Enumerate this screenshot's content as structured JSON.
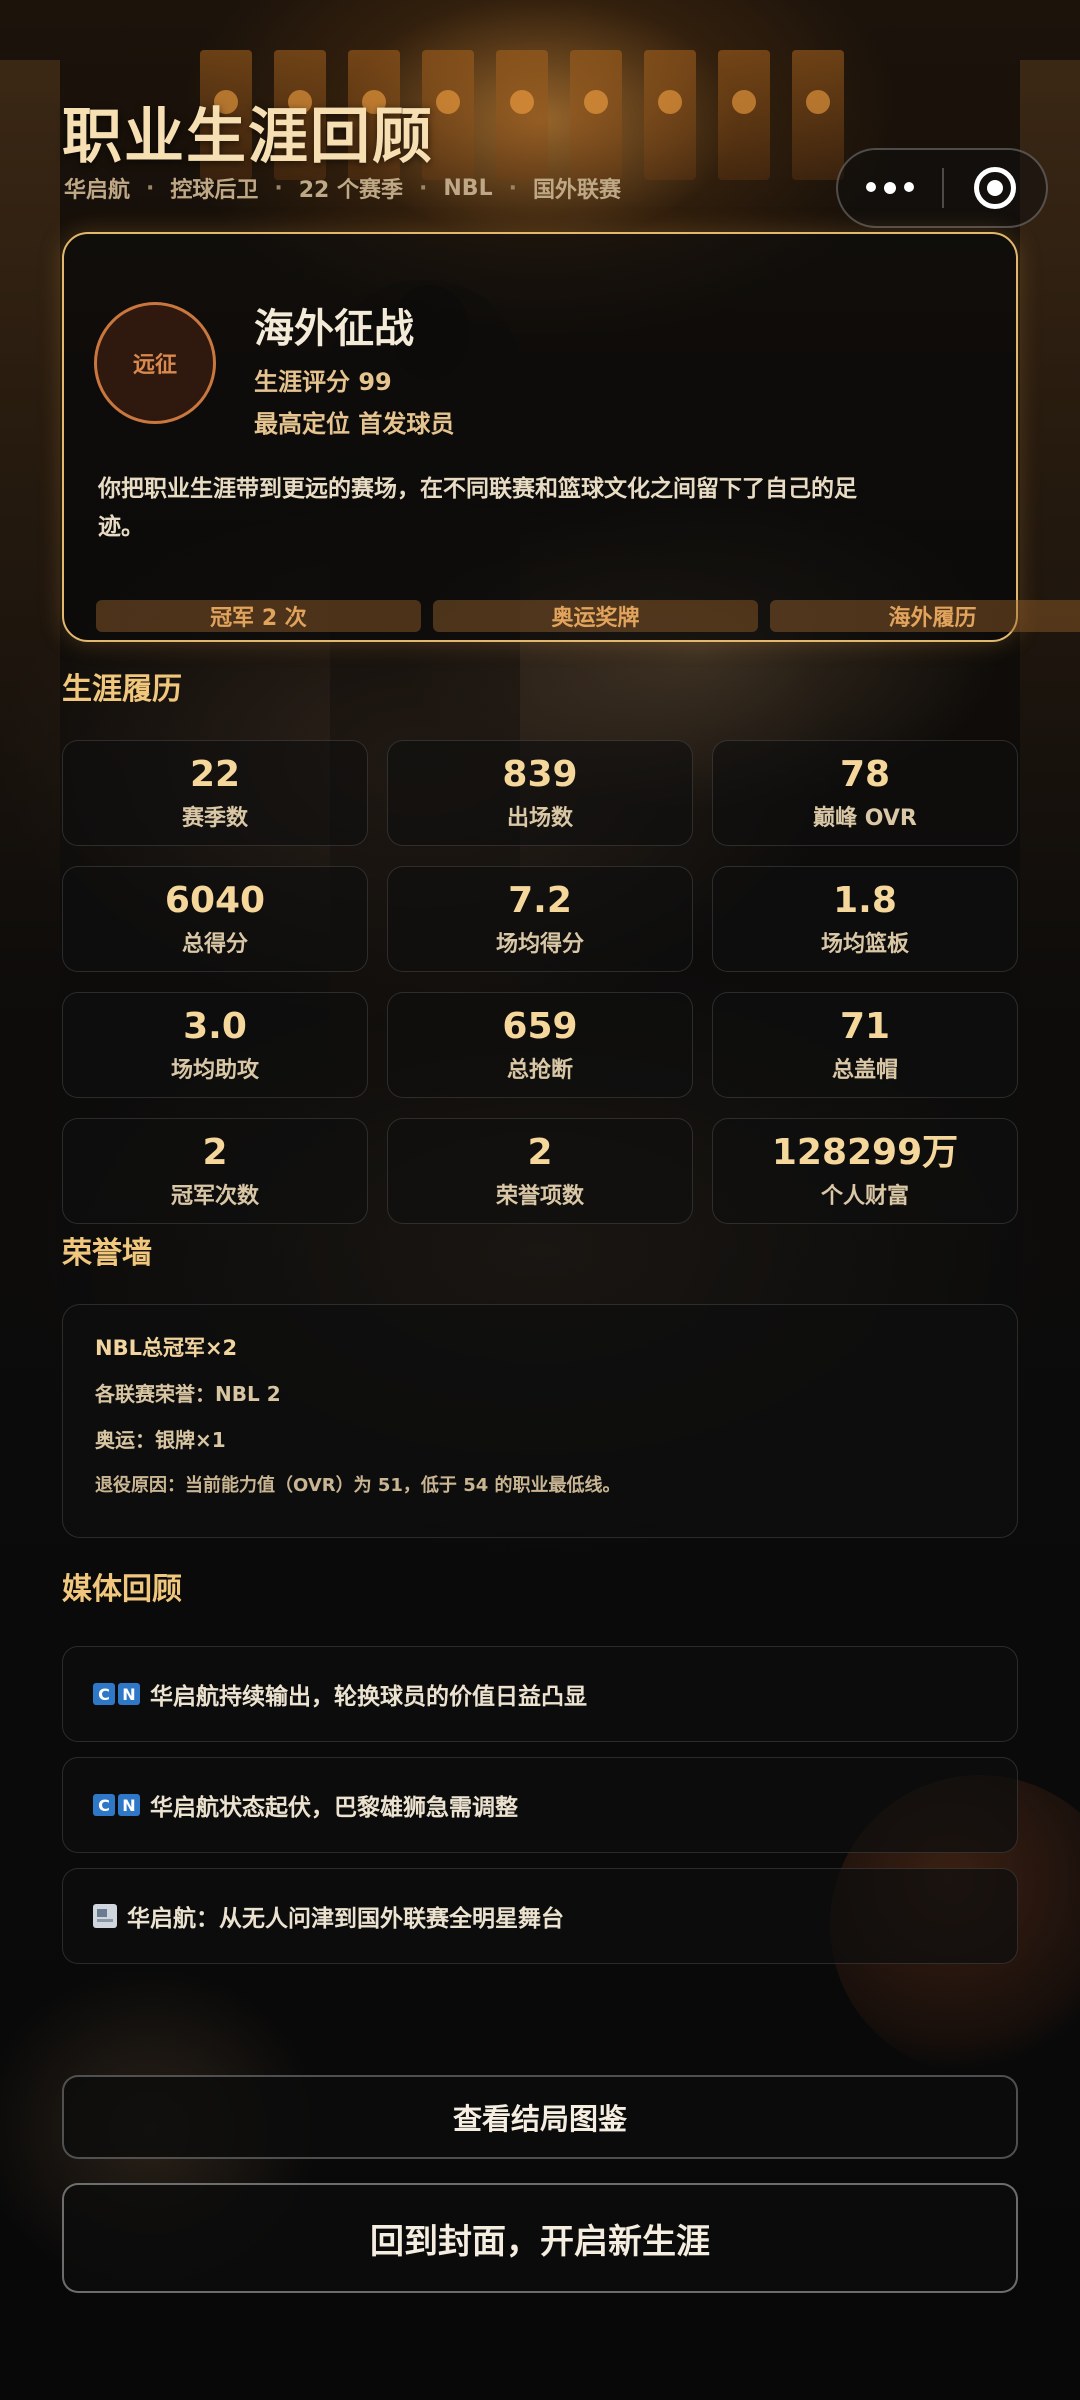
{
  "header": {
    "title": "职业生涯回顾",
    "subtitle": [
      "华启航",
      "控球后卫",
      "22 个赛季",
      "NBL",
      "国外联赛"
    ]
  },
  "ending": {
    "badge": "远征",
    "title": "海外征战",
    "score": "生涯评分 99",
    "rank": "最高定位 首发球员",
    "description": "你把职业生涯带到更远的赛场，在不同联赛和篮球文化之间留下了自己的足迹。",
    "tags": [
      "冠军 2 次",
      "奥运奖牌",
      "海外履历"
    ]
  },
  "career": {
    "title": "生涯履历",
    "stats": [
      {
        "value": "22",
        "label": "赛季数"
      },
      {
        "value": "839",
        "label": "出场数"
      },
      {
        "value": "78",
        "label": "巅峰 OVR"
      },
      {
        "value": "6040",
        "label": "总得分"
      },
      {
        "value": "7.2",
        "label": "场均得分"
      },
      {
        "value": "1.8",
        "label": "场均篮板"
      },
      {
        "value": "3.0",
        "label": "场均助攻"
      },
      {
        "value": "659",
        "label": "总抢断"
      },
      {
        "value": "71",
        "label": "总盖帽"
      },
      {
        "value": "2",
        "label": "冠军次数"
      },
      {
        "value": "2",
        "label": "荣誉项数"
      },
      {
        "value": "128299万",
        "label": "个人财富"
      }
    ]
  },
  "honors": {
    "title": "荣誉墙",
    "lines": [
      "NBL总冠军×2",
      "各联赛荣誉：NBL 2",
      "奥运：银牌×1",
      "退役原因：当前能力值（OVR）为 51，低于 54 的职业最低线。"
    ]
  },
  "media": {
    "title": "媒体回顾",
    "items": [
      {
        "icon": "cn-flag-icon",
        "flag": [
          "C",
          "N"
        ],
        "text": "华启航持续输出，轮换球员的价值日益凸显"
      },
      {
        "icon": "cn-flag-icon",
        "flag": [
          "C",
          "N"
        ],
        "text": "华启航状态起伏，巴黎雄狮急需调整"
      },
      {
        "icon": "newspaper-icon",
        "text": "华启航：从无人问津到国外联赛全明星舞台"
      }
    ]
  },
  "buttons": {
    "gallery": "查看结局图鉴",
    "restart": "回到封面，开启新生涯"
  },
  "colors": {
    "accent": "#f0c77c",
    "card_border": "#e2b86d",
    "badge": "#c9773f",
    "flag_blue": "#2f78c8"
  }
}
